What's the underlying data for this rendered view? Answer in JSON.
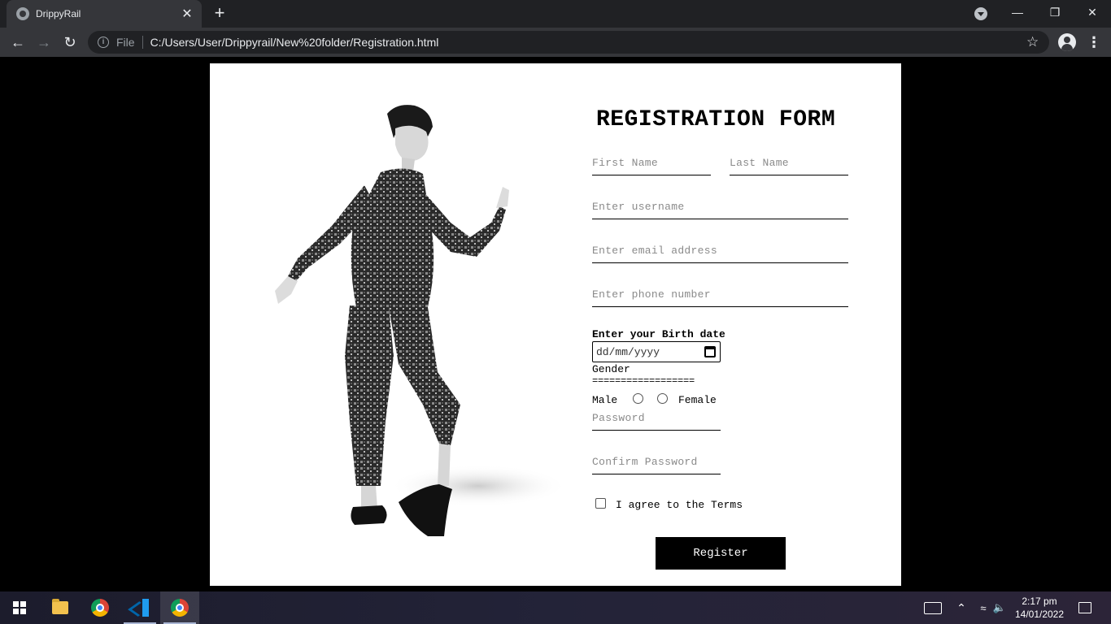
{
  "browser": {
    "tab_title": "DrippyRail",
    "tab_close": "✕",
    "new_tab": "+",
    "address_scheme_label": "File",
    "url": "C:/Users/User/Drippyrail/New%20folder/Registration.html",
    "window_minimize": "—",
    "window_restore": "❐",
    "window_close": "✕"
  },
  "form": {
    "title": "REGISTRATION FORM",
    "first_name_placeholder": "First Name",
    "last_name_placeholder": "Last Name",
    "username_placeholder": "Enter username",
    "email_placeholder": "Enter email address",
    "phone_placeholder": "Enter phone number",
    "birth_date_label": "Enter your Birth date",
    "date_placeholder": "dd/mm/yyyy",
    "gender_label": "Gender",
    "gender_divider": "==================",
    "male_label": "Male",
    "female_label": "Female",
    "password_placeholder": "Password",
    "confirm_password_placeholder": "Confirm Password",
    "terms_label": "I agree to the Terms",
    "register_label": "Register"
  },
  "taskbar": {
    "time": "2:17 pm",
    "date": "14/01/2022"
  }
}
